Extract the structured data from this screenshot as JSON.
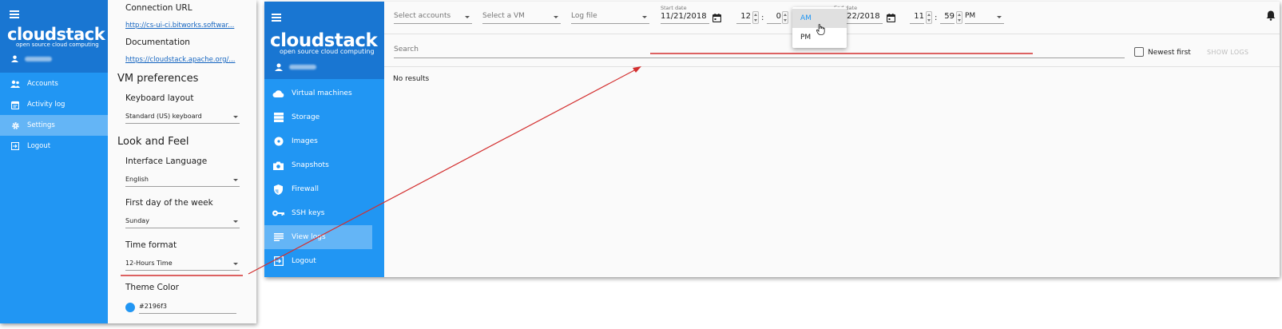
{
  "left_panel": {
    "logo": "cloudstack",
    "logo_subtitle": "open source cloud computing",
    "nav": [
      {
        "label": "Accounts",
        "icon": "accounts-icon"
      },
      {
        "label": "Activity log",
        "icon": "activity-log-icon"
      },
      {
        "label": "Settings",
        "icon": "gear-icon",
        "active": true
      },
      {
        "label": "Logout",
        "icon": "logout-icon"
      }
    ],
    "connection_url_label": "Connection URL",
    "connection_url": "http://cs-ui-ci.bitworks.softwar...",
    "documentation_label": "Documentation",
    "documentation_url": "https://cloudstack.apache.org/...",
    "vm_preferences_heading": "VM preferences",
    "keyboard_layout_label": "Keyboard layout",
    "keyboard_layout_value": "Standard (US) keyboard",
    "look_and_feel_heading": "Look and Feel",
    "interface_language_label": "Interface Language",
    "interface_language_value": "English",
    "first_day_label": "First day of the week",
    "first_day_value": "Sunday",
    "time_format_label": "Time format",
    "time_format_value": "12-Hours Time",
    "theme_color_label": "Theme Color",
    "theme_color_value": "#2196f3"
  },
  "window": {
    "logo": "cloudstack",
    "logo_subtitle": "open source cloud computing",
    "nav": [
      {
        "label": "Virtual machines",
        "icon": "cloud-icon"
      },
      {
        "label": "Storage",
        "icon": "storage-icon"
      },
      {
        "label": "Images",
        "icon": "disc-icon"
      },
      {
        "label": "Snapshots",
        "icon": "camera-icon"
      },
      {
        "label": "Firewall",
        "icon": "shield-icon"
      },
      {
        "label": "SSH keys",
        "icon": "key-icon"
      },
      {
        "label": "View logs",
        "icon": "logs-icon",
        "active": true
      },
      {
        "label": "Logout",
        "icon": "logout-icon"
      }
    ],
    "filters": {
      "accounts_placeholder": "Select accounts",
      "vm_placeholder": "Select a VM",
      "log_file_placeholder": "Log file",
      "start_date_label": "Start date",
      "start_date": "11/21/2018",
      "start_hour": "12",
      "start_minute": "0",
      "end_date_label": "End date",
      "end_date": "11/22/2018",
      "end_hour": "11",
      "end_minute": "59",
      "end_period": "PM"
    },
    "period_menu": {
      "options": [
        "AM",
        "PM"
      ],
      "highlighted": "AM"
    },
    "search_placeholder": "Search",
    "newest_first_label": "Newest first",
    "show_logs_label": "SHOW LOGS",
    "no_results": "No results"
  },
  "colors": {
    "sidebar": "#2196f3",
    "sidebar_header": "#1976d2",
    "active_item": "#64b5f6",
    "annotation": "#d32f2f"
  }
}
